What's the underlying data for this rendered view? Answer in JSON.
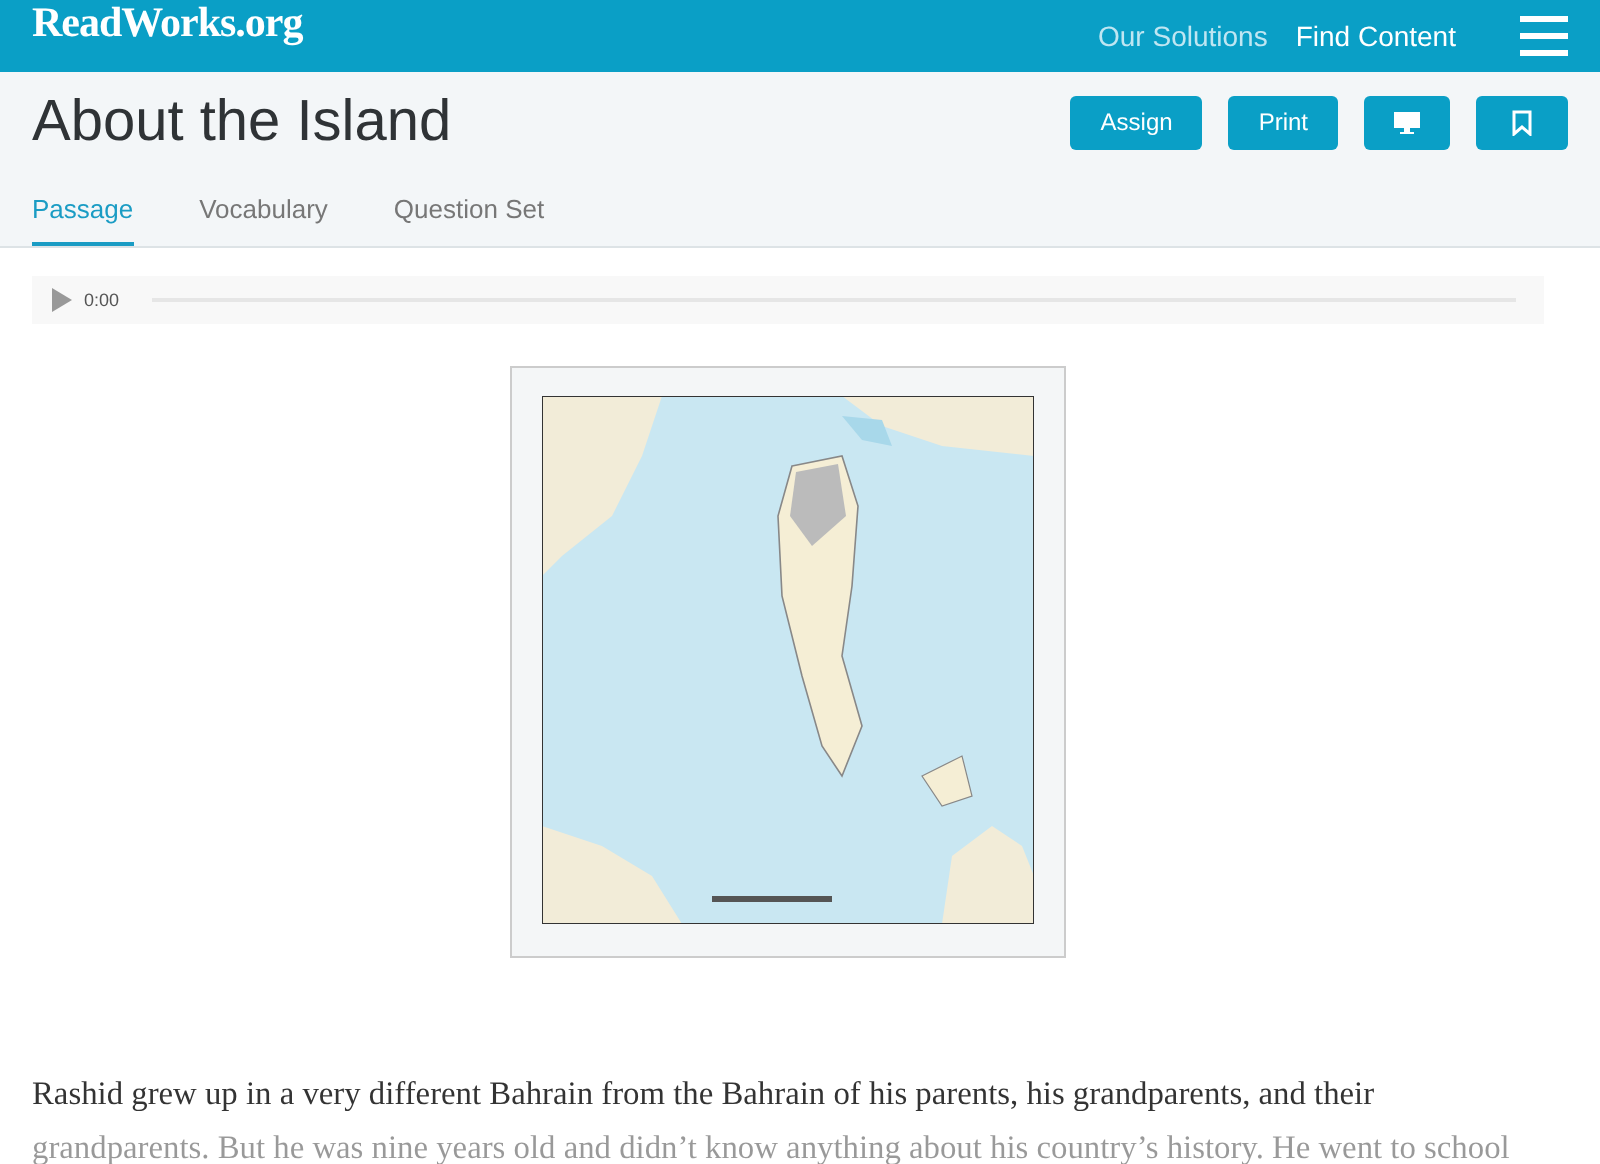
{
  "header": {
    "logo": "ReadWorks.org",
    "nav": [
      "Our Solutions",
      "Find Content"
    ]
  },
  "title": "About the Island",
  "actions": [
    {
      "kind": "text",
      "label": "Assign"
    },
    {
      "kind": "text",
      "label": "Print"
    },
    {
      "kind": "monitor"
    },
    {
      "kind": "bookmark"
    }
  ],
  "tabs": [
    {
      "label": "Passage",
      "selected": true
    },
    {
      "label": "Vocabulary",
      "selected": false
    },
    {
      "label": "Question Set",
      "selected": false
    }
  ],
  "audio": {
    "time": "0:00"
  },
  "passage": "Rashid grew up in a very different Bahrain from the Bahrain of his parents, his grandparents, and their grandparents. But he was nine years old and didn’t know anything about his country’s history. He went to school"
}
